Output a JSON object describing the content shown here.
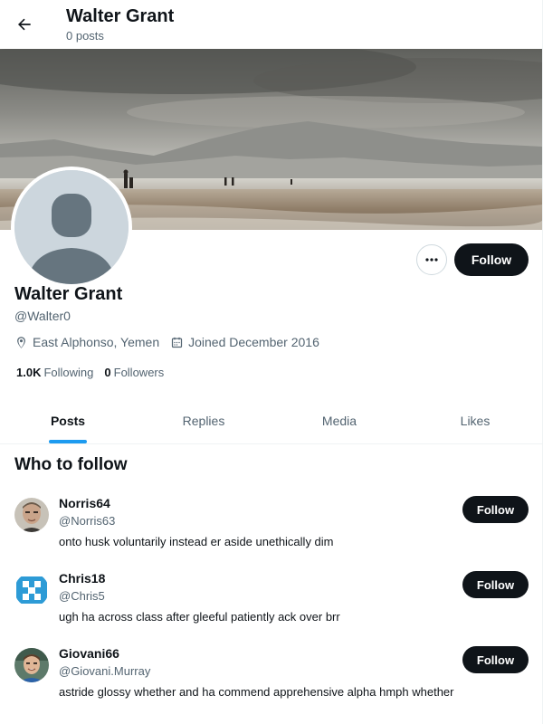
{
  "header": {
    "title": "Walter Grant",
    "post_count": "0 posts"
  },
  "profile": {
    "name": "Walter Grant",
    "handle": "@Walter0",
    "location": "East Alphonso, Yemen",
    "joined": "Joined December 2016",
    "following_count": "1.0K",
    "following_label": "Following",
    "followers_count": "0",
    "followers_label": "Followers",
    "follow_label": "Follow"
  },
  "tabs": [
    {
      "label": "Posts",
      "active": true
    },
    {
      "label": "Replies",
      "active": false
    },
    {
      "label": "Media",
      "active": false
    },
    {
      "label": "Likes",
      "active": false
    }
  ],
  "who_to_follow": {
    "title": "Who to follow",
    "suggestions": [
      {
        "name": "Norris64",
        "handle": "@Norris63",
        "bio": "onto husk voluntarily instead er aside unethically dim",
        "follow_label": "Follow",
        "avatar": "photo-avatar"
      },
      {
        "name": "Chris18",
        "handle": "@Chris5",
        "bio": "ugh ha across class after gleeful patiently ack over brr",
        "follow_label": "Follow",
        "avatar": "pattern-avatar"
      },
      {
        "name": "Giovani66",
        "handle": "@Giovani.Murray",
        "bio": "astride glossy whether and ha commend apprehensive alpha hmph whether",
        "follow_label": "Follow",
        "avatar": "photo-avatar"
      }
    ]
  },
  "colors": {
    "accent": "#1d9bf0",
    "text_primary": "#0f1419",
    "text_secondary": "#536471",
    "button_dark": "#0f1419"
  }
}
